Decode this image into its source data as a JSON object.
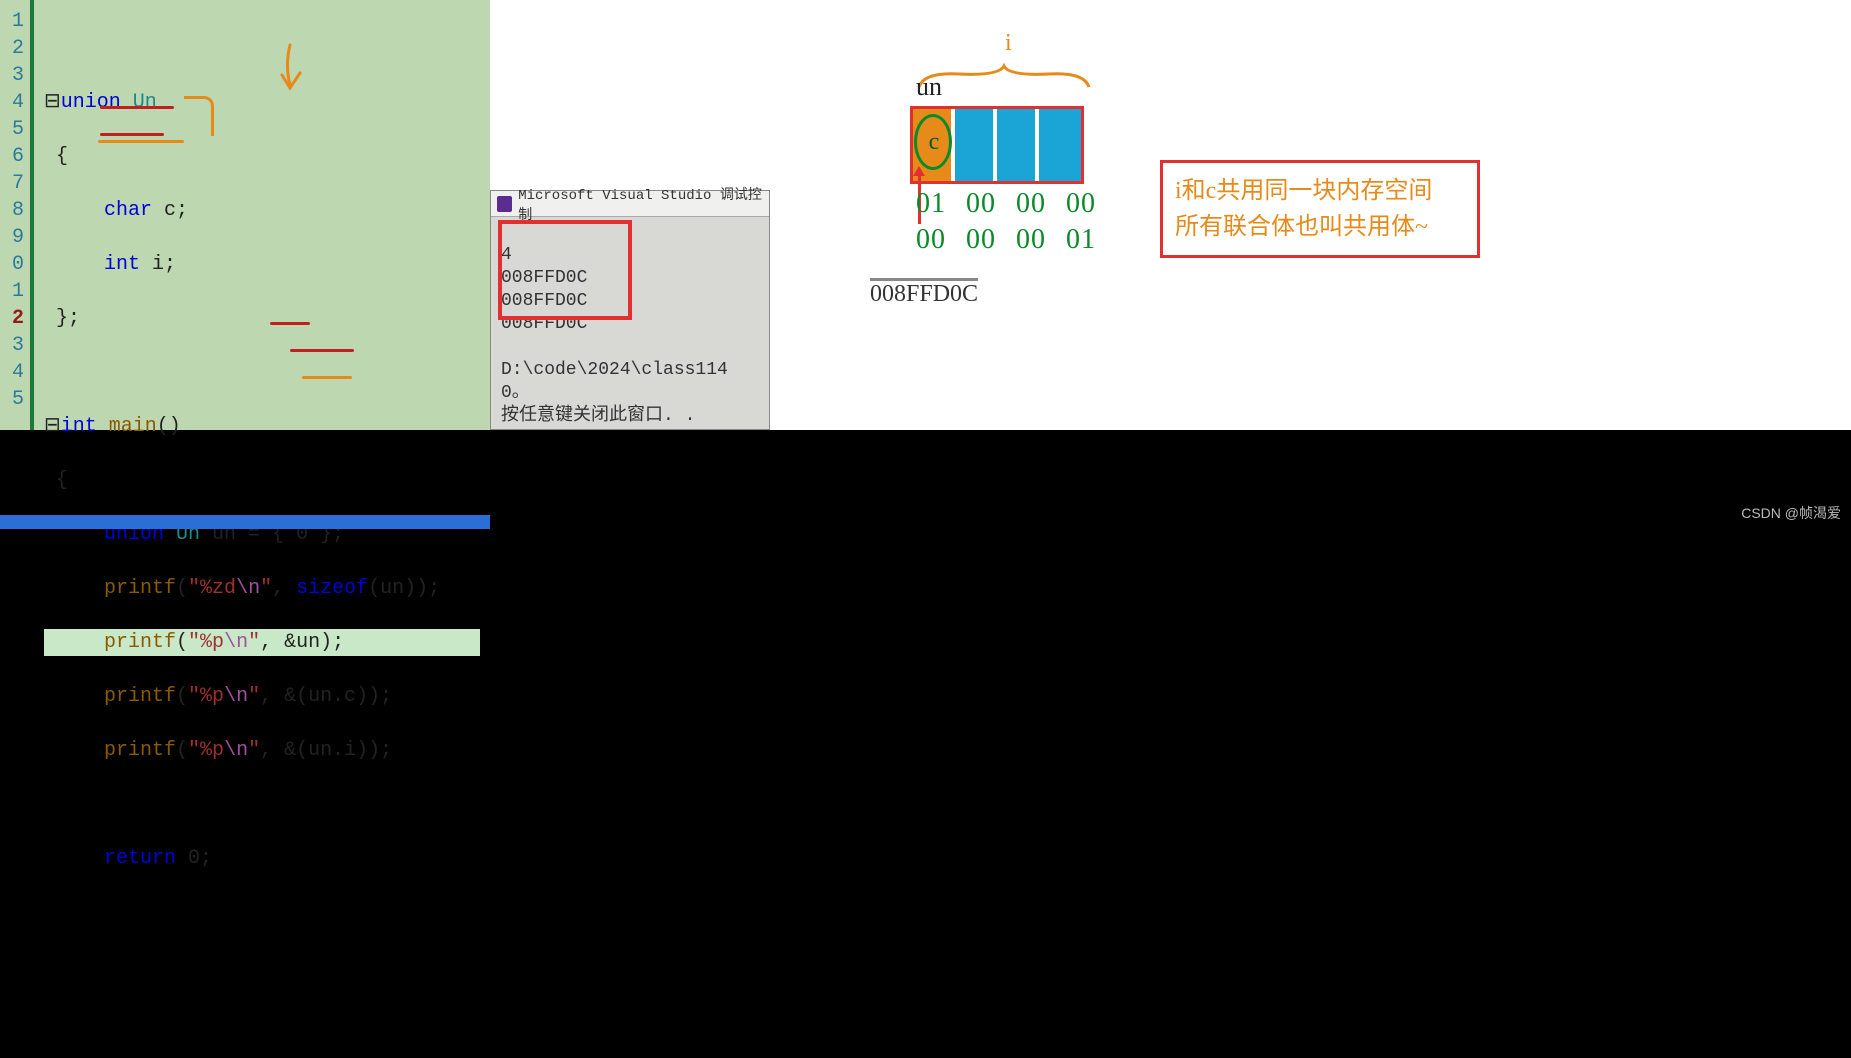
{
  "code": {
    "gutter": [
      "1",
      "2",
      "3",
      "4",
      "5",
      "6",
      "7",
      "8",
      "9",
      "0",
      "1",
      "2",
      "3",
      "4",
      "5"
    ],
    "breakpoint_line": "2",
    "lines": {
      "l1": "",
      "l2_kw": "union",
      "l2_typ": " Un",
      "l3": "{",
      "l4_kw": "char",
      "l4_rest": " c;",
      "l5_kw": "int",
      "l5_rest": " i;",
      "l6": "};",
      "l7": "",
      "l8_kw": "int",
      "l8_fn": " main",
      "l8_rest": "()",
      "l9": "{",
      "l10_kw": "union",
      "l10_typ": " Un",
      "l10_rest": " un = { 0 };",
      "l11_fn": "printf",
      "l11_p1": "(",
      "l11_str1": "\"%zd",
      "l11_esc": "\\n",
      "l11_str2": "\"",
      "l11_p2": ", ",
      "l11_kw": "sizeof",
      "l11_p3": "(un));",
      "l12_fn": "printf",
      "l12_p1": "(",
      "l12_str1": "\"%p",
      "l12_esc": "\\n",
      "l12_str2": "\"",
      "l12_p2": ", &un);",
      "l13_fn": "printf",
      "l13_p1": "(",
      "l13_str1": "\"%p",
      "l13_esc": "\\n",
      "l13_str2": "\"",
      "l13_p2": ", &(un.c));",
      "l14_fn": "printf",
      "l14_p1": "(",
      "l14_str1": "\"%p",
      "l14_esc": "\\n",
      "l14_str2": "\"",
      "l14_p2": ", &(un.i));",
      "l15": "",
      "l16_kw": "return",
      "l16_rest": " 0;"
    }
  },
  "console": {
    "title": "Microsoft Visual Studio 调试控制",
    "out": [
      "4",
      "008FFD0C",
      "008FFD0C",
      "008FFD0C"
    ],
    "path": "D:\\code\\2024\\class114",
    "zero": "0。",
    "prompt": "按任意键关闭此窗口. ."
  },
  "diagram": {
    "i_label": "i",
    "un_label": "un",
    "c_label": "c",
    "hex_r1": [
      "01",
      "00",
      "00",
      "00"
    ],
    "hex_r2": [
      "00",
      "00",
      "00",
      "01"
    ],
    "addr": "008FFD0C"
  },
  "note": {
    "line1": "i和c共用同一块内存空间",
    "line2": "所有联合体也叫共用体~"
  },
  "watermark": "CSDN @帧渴爱"
}
